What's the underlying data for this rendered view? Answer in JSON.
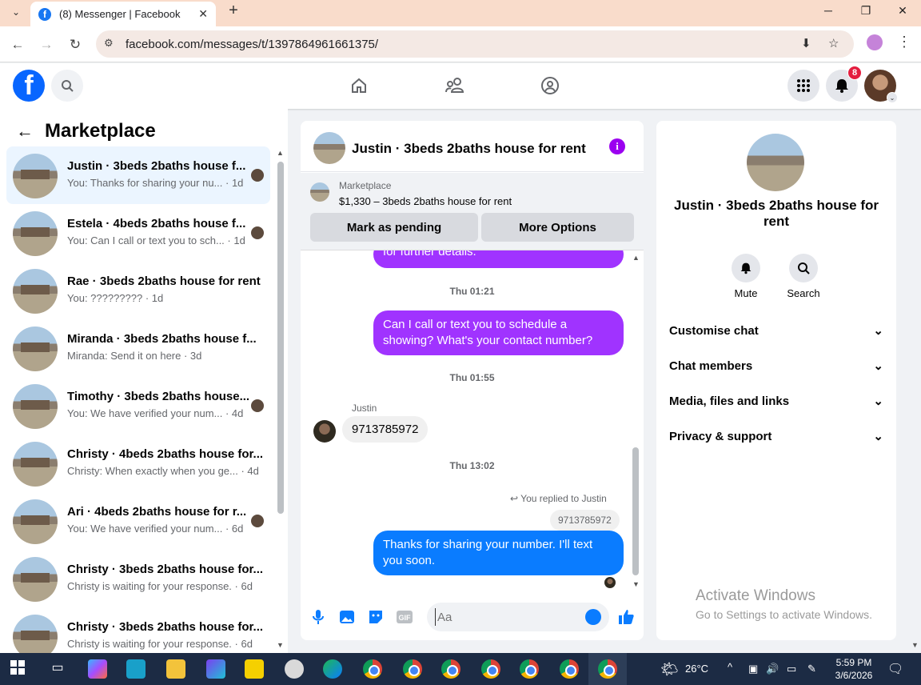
{
  "browser": {
    "tab_title": "(8) Messenger | Facebook",
    "url": "facebook.com/messages/t/1397864961661375/"
  },
  "header": {
    "notification_count": "8"
  },
  "sidebar": {
    "title": "Marketplace",
    "conversations": [
      {
        "name": "Justin · 3beds 2baths house f...",
        "snippet": "You: Thanks for sharing your nu... · 1d",
        "active": true
      },
      {
        "name": "Estela · 4beds 2baths house f...",
        "snippet": "You: Can I call or text you to sch... · 1d"
      },
      {
        "name": "Rae · 3beds 2baths house for rent",
        "snippet": "You: ????????? · 1d"
      },
      {
        "name": "Miranda · 3beds 2baths house f...",
        "snippet": "Miranda: Send it on here · 3d"
      },
      {
        "name": "Timothy · 3beds 2baths house...",
        "snippet": "You: We have verified your num... · 4d"
      },
      {
        "name": "Christy · 4beds 2baths house for...",
        "snippet": "Christy: When exactly when you ge... · 4d"
      },
      {
        "name": "Ari · 4beds 2baths house for r...",
        "snippet": "You: We have verified your num... · 6d"
      },
      {
        "name": "Christy · 3beds 2baths house for...",
        "snippet": "Christy is waiting for your response. · 6d"
      },
      {
        "name": "Christy · 3beds 2baths house for...",
        "snippet": "Christy is waiting for your response. · 6d"
      }
    ]
  },
  "chat": {
    "title": "Justin · 3beds 2baths house for rent",
    "marketplace_label": "Marketplace",
    "listing": "$1,330 – 3beds 2baths house for rent",
    "mark_pending": "Mark as pending",
    "more_options": "More Options",
    "partial_message": "for further details.",
    "ts1": "Thu 01:21",
    "msg_call": "Can I call or text you to schedule a showing? What's your contact number?",
    "ts2": "Thu 01:55",
    "sender": "Justin",
    "msg_number": "9713785972",
    "ts3": "Thu 13:02",
    "reply_header": "You replied to Justin",
    "reply_quote": "9713785972",
    "msg_thanks": "Thanks for sharing your number. I'll text you soon.",
    "input_placeholder": "Aa"
  },
  "details": {
    "title": "Justin · 3beds 2baths house for rent",
    "mute": "Mute",
    "search": "Search",
    "sections": [
      "Customise chat",
      "Chat members",
      "Media, files and links",
      "Privacy & support"
    ]
  },
  "watermark": {
    "line1": "Activate Windows",
    "line2": "Go to Settings to activate Windows."
  },
  "taskbar": {
    "temperature": "26°C",
    "time": "5:59 PM",
    "date": "3/6/2026"
  }
}
